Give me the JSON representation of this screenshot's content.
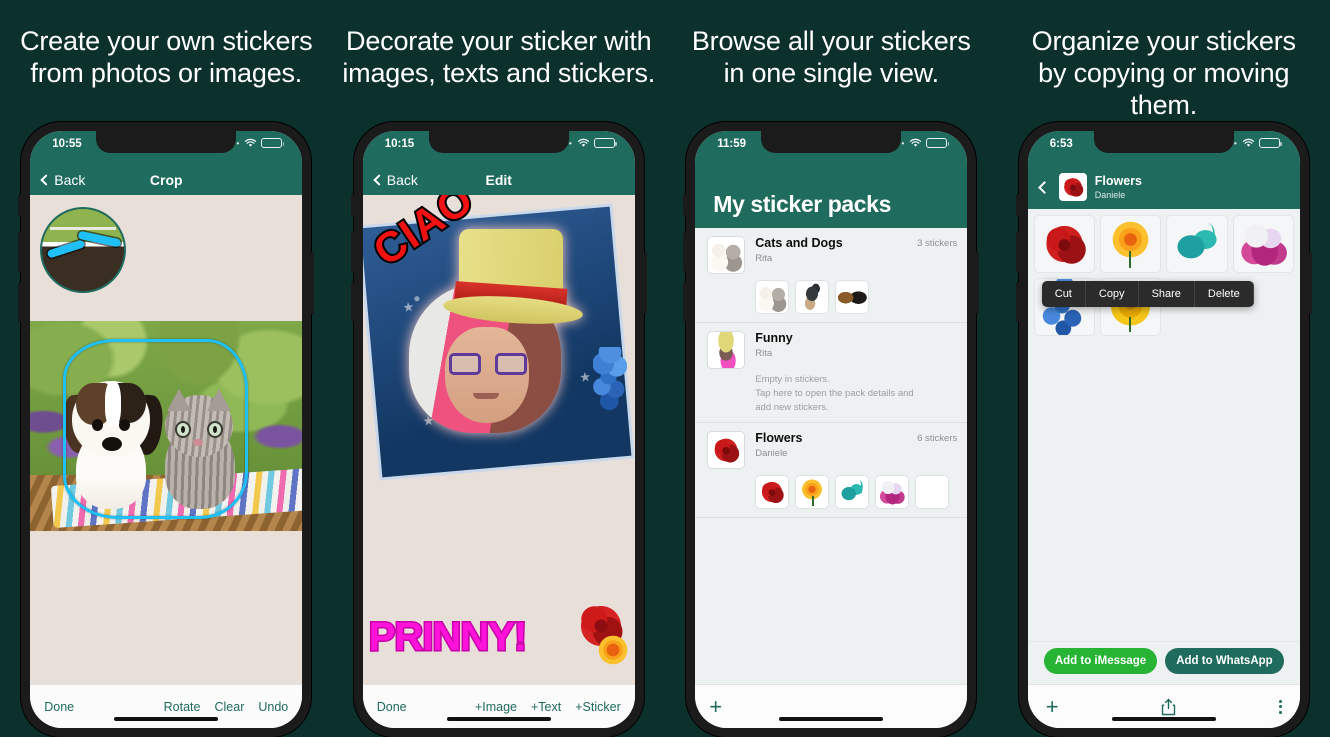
{
  "theme": {
    "background": "#0c302c",
    "accent_teal": "#1f6b5e",
    "imessage_green": "#27b333",
    "crop_outline": "#1fc0f5"
  },
  "panels": [
    {
      "headline_line1": "Create your own stickers",
      "headline_line2": "from photos or images.",
      "status_time": "10:55",
      "nav": {
        "back": "Back",
        "title": "Crop"
      },
      "toolbar": {
        "done": "Done",
        "rotate": "Rotate",
        "clear": "Clear",
        "undo": "Undo"
      }
    },
    {
      "headline_line1": "Decorate your sticker with",
      "headline_line2": "images, texts and stickers.",
      "status_time": "10:15",
      "nav": {
        "back": "Back",
        "title": "Edit"
      },
      "canvas": {
        "text_top": "CIAO",
        "text_bottom": "PRINNY!"
      },
      "toolbar": {
        "done": "Done",
        "add_image": "+Image",
        "add_text": "+Text",
        "add_sticker": "+Sticker"
      }
    },
    {
      "headline_line1": "Browse all your stickers",
      "headline_line2": "in one single view.",
      "status_time": "11:59",
      "big_title": "My sticker packs",
      "packs": [
        {
          "name": "Cats and Dogs",
          "author": "Rita",
          "count": "3 stickers",
          "cover_icon": "puppy-kitten-icon",
          "stickers": [
            "puppy-kitten-icon",
            "dog-icon",
            "two-animals-icon"
          ],
          "empty_message": ""
        },
        {
          "name": "Funny",
          "author": "Rita",
          "count": "",
          "cover_icon": "funny-hat-icon",
          "stickers": [],
          "empty_message": "Empty in stickers.\nTap here to open the pack details and\nadd new stickers."
        },
        {
          "name": "Flowers",
          "author": "Daniele",
          "count": "6 stickers",
          "cover_icon": "rose-icon",
          "stickers": [
            "rose-icon",
            "marigold-icon",
            "teal-flower-icon",
            "orchid-icon",
            "blank-icon"
          ],
          "empty_message": ""
        }
      ],
      "toolbar": {
        "add": "+"
      }
    },
    {
      "headline_line1": "Organize your stickers",
      "headline_line2": "by copying or moving them.",
      "status_time": "6:53",
      "nav": {
        "pack_name": "Flowers",
        "pack_author": "Daniele"
      },
      "grid_stickers": [
        "rose-icon",
        "marigold-icon",
        "teal-flower-icon",
        "orchid-icon",
        "blue-grape-icon",
        "yellow-dahlia-icon"
      ],
      "context_menu": [
        "Cut",
        "Copy",
        "Share",
        "Delete"
      ],
      "buttons": {
        "imessage": "Add to iMessage",
        "whatsapp": "Add to WhatsApp"
      },
      "toolbar_icons": [
        "plus-icon",
        "share-icon",
        "more-icon"
      ]
    }
  ]
}
